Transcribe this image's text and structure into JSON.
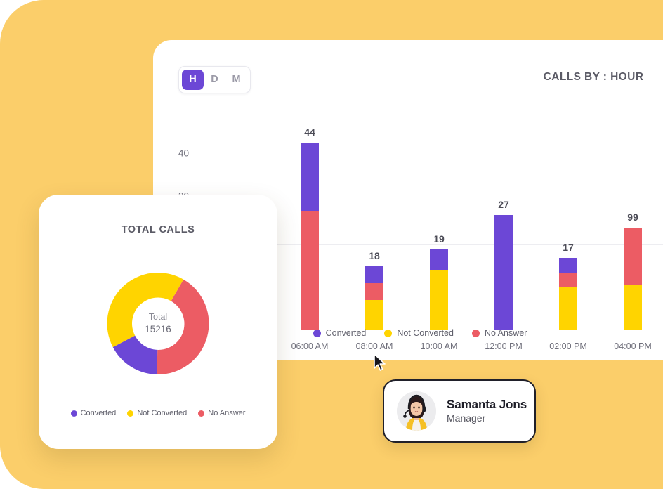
{
  "colors": {
    "background": "#FBCE6A",
    "converted": "#6C47D6",
    "not_converted": "#FFD400",
    "no_answer": "#EC5C64",
    "card": "#FFFFFF",
    "text_muted": "#6F6F7B"
  },
  "bar_panel": {
    "title": "CALLS BY : HOUR",
    "period_options": [
      {
        "label": "H",
        "active": true
      },
      {
        "label": "D",
        "active": false
      },
      {
        "label": "M",
        "active": false
      }
    ],
    "legend": [
      {
        "label": "Converted",
        "color": "#6C47D6"
      },
      {
        "label": "Not Converted",
        "color": "#FFD400"
      },
      {
        "label": "No Answer",
        "color": "#EC5C64"
      }
    ]
  },
  "donut_panel": {
    "title": "TOTAL CALLS",
    "center_label": "Total",
    "center_value": "15216",
    "legend": [
      {
        "label": "Converted",
        "color": "#6C47D6"
      },
      {
        "label": "Not Converted",
        "color": "#FFD400"
      },
      {
        "label": "No Answer",
        "color": "#EC5C64"
      }
    ]
  },
  "profile": {
    "name": "Samanta Jons",
    "role": "Manager",
    "avatar_alt": "avatar-photo"
  },
  "chart_data": [
    {
      "type": "bar",
      "id": "calls-by-hour",
      "title": "CALLS BY : HOUR",
      "stacked": true,
      "xlabel": "",
      "ylabel": "",
      "ylim": [
        0,
        48
      ],
      "grid": true,
      "yticks": [
        0,
        10,
        20,
        30,
        40
      ],
      "ytick_labels_visible": [
        "40",
        "30"
      ],
      "legend_position": "bottom",
      "categories": [
        "06:00 AM",
        "08:00 AM",
        "10:00 AM",
        "12:00 PM",
        "02:00 PM",
        "04:00 PM"
      ],
      "data_labels": [
        "44",
        "18",
        "19",
        "27",
        "17",
        "99"
      ],
      "series": [
        {
          "name": "Converted",
          "color": "#6C47D6",
          "values": [
            16,
            4,
            5,
            27,
            3.5,
            0
          ]
        },
        {
          "name": "No Answer",
          "color": "#EC5C64",
          "values": [
            28,
            4,
            0,
            0,
            3.5,
            13.5
          ]
        },
        {
          "name": "Not Converted",
          "color": "#FFD400",
          "values": [
            0,
            7,
            14,
            0,
            10,
            10.5
          ]
        }
      ],
      "segment_order_bottom_to_top": [
        "Not Converted",
        "No Answer",
        "Converted"
      ]
    },
    {
      "type": "pie",
      "id": "total-calls-donut",
      "title": "TOTAL CALLS",
      "donut": true,
      "center_label": "Total",
      "center_value": 15216,
      "legend_position": "bottom",
      "labels": [
        "Converted",
        "Not Converted",
        "No Answer"
      ],
      "colors": [
        "#6C47D6",
        "#FFD400",
        "#EC5C64"
      ],
      "values": [
        17,
        41,
        42
      ],
      "unit": "percent"
    }
  ]
}
